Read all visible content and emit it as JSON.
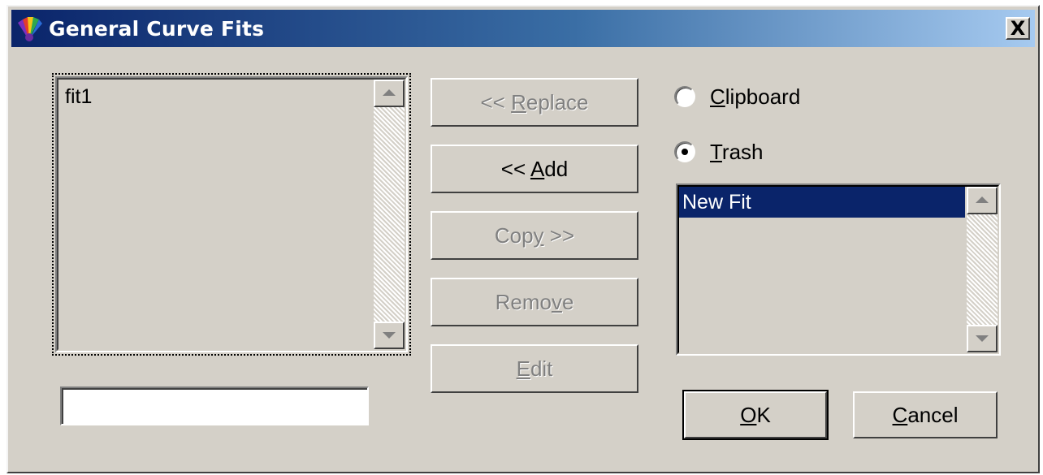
{
  "window": {
    "title": "General Curve Fits",
    "close_label": "X"
  },
  "left_list": {
    "items": [
      "fit1"
    ]
  },
  "name_field": {
    "value": "",
    "placeholder": ""
  },
  "buttons": {
    "replace": {
      "pre": "<< ",
      "key": "R",
      "post": "eplace",
      "enabled": false
    },
    "add": {
      "pre": "<< ",
      "key": "A",
      "post": "dd",
      "enabled": true
    },
    "copy": {
      "pre": "Cop",
      "key": "y",
      "post": " >>",
      "enabled": false
    },
    "remove": {
      "pre": "Remo",
      "key": "v",
      "post": "e",
      "enabled": false
    },
    "edit": {
      "pre": "",
      "key": "E",
      "post": "dit",
      "enabled": false
    },
    "ok": {
      "pre": "",
      "key": "O",
      "post": "K",
      "enabled": true
    },
    "cancel": {
      "pre": "",
      "key": "C",
      "post": "ancel",
      "enabled": true
    }
  },
  "radios": {
    "clipboard": {
      "pre": "",
      "key": "C",
      "post": "lipboard",
      "checked": false
    },
    "trash": {
      "pre": "",
      "key": "T",
      "post": "rash",
      "checked": true
    }
  },
  "right_list": {
    "items": [
      "New Fit"
    ],
    "selected_index": 0
  },
  "colors": {
    "title_start": "#0a246a",
    "title_end": "#a6caf0",
    "face": "#d4d0c8",
    "selection": "#0a246a"
  }
}
